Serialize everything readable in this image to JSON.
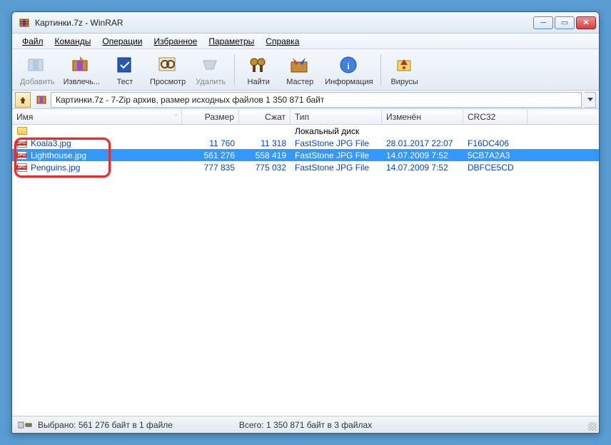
{
  "window": {
    "title": "Картинки.7z - WinRAR"
  },
  "menu": {
    "file": "Файл",
    "commands": "Команды",
    "operations": "Операции",
    "favorites": "Избранное",
    "options": "Параметры",
    "help": "Справка"
  },
  "toolbar": {
    "add": "Добавить",
    "extract": "Извлечь...",
    "test": "Тест",
    "view": "Просмотр",
    "delete": "Удалить",
    "find": "Найти",
    "wizard": "Мастер",
    "info": "Информация",
    "virus": "Вирусы"
  },
  "path": {
    "text": "Картинки.7z - 7-Zip архив, размер исходных файлов 1 350 871 байт"
  },
  "columns": {
    "name": "Имя",
    "size": "Размер",
    "packed": "Сжат",
    "type": "Тип",
    "modified": "Изменён",
    "crc": "CRC32"
  },
  "rows": {
    "parent": {
      "type": "Локальный диск"
    },
    "r0": {
      "name": "Koala3.jpg",
      "size": "11 760",
      "packed": "11 318",
      "type": "FastStone JPG File",
      "modified": "28.01.2017 22:07",
      "crc": "F16DC406"
    },
    "r1": {
      "name": "Lighthouse.jpg",
      "size": "561 276",
      "packed": "558 419",
      "type": "FastStone JPG File",
      "modified": "14.07.2009 7:52",
      "crc": "5CB7A2A3"
    },
    "r2": {
      "name": "Penguins.jpg",
      "size": "777 835",
      "packed": "775 032",
      "type": "FastStone JPG File",
      "modified": "14.07.2009 7:52",
      "crc": "DBFCE5CD"
    }
  },
  "status": {
    "selection": "Выбрано: 561 276 байт в 1 файле",
    "total": "Всего: 1 350 871 байт в 3 файлах"
  }
}
